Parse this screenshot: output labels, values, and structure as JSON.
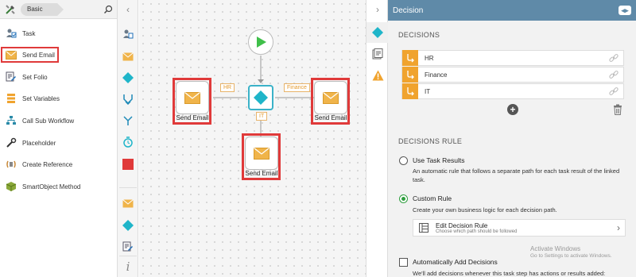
{
  "toolbox": {
    "category": "Basic",
    "items": [
      {
        "label": "Task",
        "icon": "task-icon"
      },
      {
        "label": "Send Email",
        "icon": "envelope-icon"
      },
      {
        "label": "Set Folio",
        "icon": "folio-icon"
      },
      {
        "label": "Set Variables",
        "icon": "variables-icon"
      },
      {
        "label": "Call Sub Workflow",
        "icon": "sub-workflow-icon"
      },
      {
        "label": "Placeholder",
        "icon": "wrench-icon"
      },
      {
        "label": "Create Reference",
        "icon": "reference-icon"
      },
      {
        "label": "SmartObject Method",
        "icon": "smartobject-icon"
      }
    ]
  },
  "canvas": {
    "nodes": {
      "left": "Send Email",
      "right": "Send Email",
      "bottom": "Send Email"
    },
    "line_labels": {
      "hr": "HR",
      "finance": "Finance",
      "it": "IT"
    }
  },
  "panel": {
    "title": "Decision",
    "decisions_heading": "DECISIONS",
    "decisions": [
      "HR",
      "Finance",
      "IT"
    ],
    "rule_heading": "DECISIONS RULE",
    "use_task_results": {
      "label": "Use Task Results",
      "desc": "An automatic rule that follows a separate path for each task result of the linked task."
    },
    "custom_rule": {
      "label": "Custom Rule",
      "desc": "Create your own business logic for each decision path."
    },
    "edit_rule": {
      "title": "Edit Decision Rule",
      "subtitle": "Choose which path should be followed"
    },
    "auto_add": {
      "label": "Automatically Add Decisions",
      "desc": "We'll add decisions whenever this task step has actions or results added:"
    },
    "watermark": {
      "line1": "Activate Windows",
      "line2": "Go to Settings to activate Windows."
    }
  },
  "colors": {
    "accent_orange": "#f0a32e",
    "accent_teal": "#1fb5c9",
    "header_blue": "#5f8aa8",
    "highlight_red": "#e03a3a",
    "start_green": "#3fbf4a"
  }
}
